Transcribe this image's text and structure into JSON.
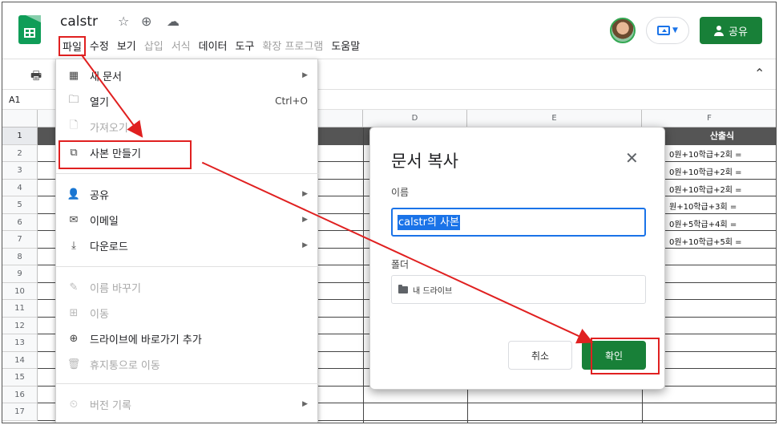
{
  "app": {
    "doc_title": "calstr"
  },
  "header": {
    "star_icon": "star-icon",
    "move_icon": "drive-move-icon",
    "cloud_icon": "cloud-status-icon",
    "share_label": "공유"
  },
  "menubar": {
    "items": [
      {
        "label": "파일",
        "disabled": false
      },
      {
        "label": "수정",
        "disabled": false
      },
      {
        "label": "보기",
        "disabled": false
      },
      {
        "label": "삽입",
        "disabled": true
      },
      {
        "label": "서식",
        "disabled": true
      },
      {
        "label": "데이터",
        "disabled": false
      },
      {
        "label": "도구",
        "disabled": false
      },
      {
        "label": "확장 프로그램",
        "disabled": true
      },
      {
        "label": "도움말",
        "disabled": false
      }
    ]
  },
  "namebox": {
    "cell": "A1"
  },
  "grid": {
    "columns": [
      "D",
      "E",
      "F"
    ],
    "rows": [
      "1",
      "2",
      "3",
      "4",
      "5",
      "6",
      "7",
      "8",
      "9",
      "10",
      "11",
      "12",
      "13",
      "14",
      "15",
      "16",
      "17"
    ],
    "f_header": "산출식",
    "f_cells": [
      "0원+10학급+2회 =",
      "0원+10학급+2회 =",
      "0원+10학급+2회 =",
      "원+10학급+3회 =",
      "0원+5학급+4회 =",
      "0원+10학급+5회 ="
    ]
  },
  "file_menu": {
    "items": [
      {
        "label": "새 문서",
        "icon": "new-sheet-icon",
        "shortcut": "",
        "submenu": true,
        "disabled": false
      },
      {
        "label": "열기",
        "icon": "folder-open-icon",
        "shortcut": "Ctrl+O",
        "submenu": false,
        "disabled": false
      },
      {
        "label": "가져오기",
        "icon": "import-icon",
        "shortcut": "",
        "submenu": false,
        "disabled": true
      },
      {
        "label": "사본 만들기",
        "icon": "copy-icon",
        "shortcut": "",
        "submenu": false,
        "disabled": false
      },
      {
        "label": "공유",
        "icon": "share-person-icon",
        "shortcut": "",
        "submenu": true,
        "disabled": false
      },
      {
        "label": "이메일",
        "icon": "email-icon",
        "shortcut": "",
        "submenu": true,
        "disabled": false
      },
      {
        "label": "다운로드",
        "icon": "download-icon",
        "shortcut": "",
        "submenu": true,
        "disabled": false
      },
      {
        "label": "이름 바꾸기",
        "icon": "rename-icon",
        "shortcut": "",
        "submenu": false,
        "disabled": true
      },
      {
        "label": "이동",
        "icon": "move-folder-icon",
        "shortcut": "",
        "submenu": false,
        "disabled": true
      },
      {
        "label": "드라이브에 바로가기 추가",
        "icon": "drive-shortcut-icon",
        "shortcut": "",
        "submenu": false,
        "disabled": false
      },
      {
        "label": "휴지통으로 이동",
        "icon": "trash-icon",
        "shortcut": "",
        "submenu": false,
        "disabled": true
      },
      {
        "label": "버전 기록",
        "icon": "history-icon",
        "shortcut": "",
        "submenu": true,
        "disabled": true
      }
    ]
  },
  "dialog": {
    "title": "문서 복사",
    "name_label": "이름",
    "name_value": "calstr의 사본",
    "folder_label": "폴더",
    "folder_value": "내 드라이브",
    "cancel_label": "취소",
    "ok_label": "확인"
  },
  "annotation_color": "#e02020"
}
